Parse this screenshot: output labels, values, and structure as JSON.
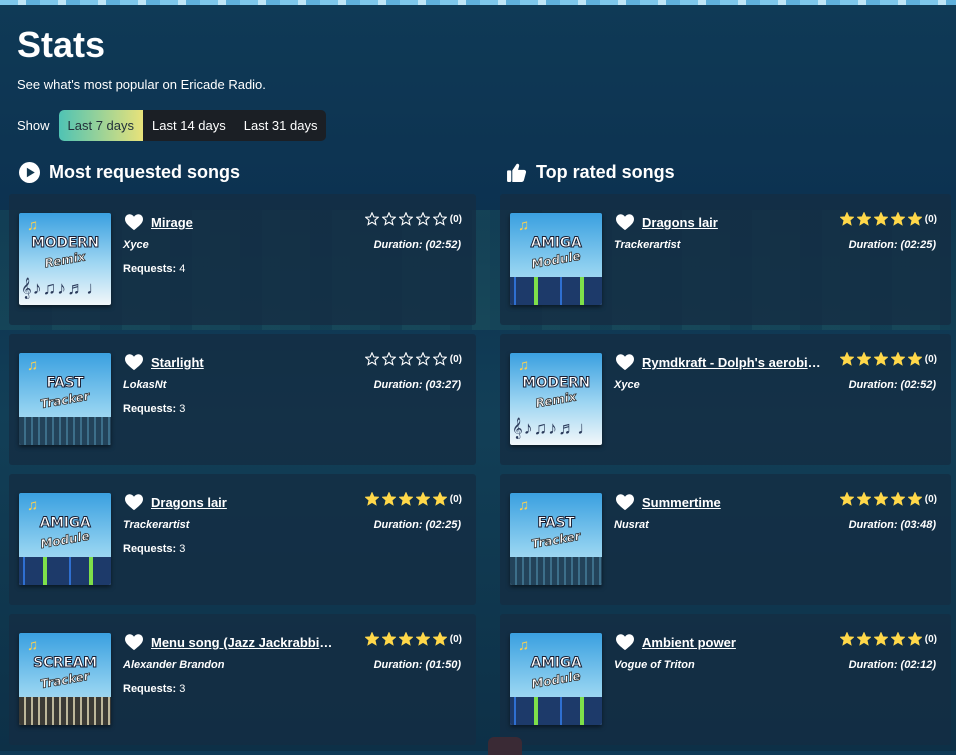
{
  "page": {
    "title": "Stats",
    "subtitle": "See what's most popular on Ericade Radio."
  },
  "filter": {
    "label": "Show",
    "options": [
      "Last 7 days",
      "Last 14 days",
      "Last 31 days"
    ],
    "selected": "Last 7 days"
  },
  "colors": {
    "star_filled": "#ffd84a",
    "accent_gradient": [
      "#4fc3b4",
      "#e8e27a"
    ]
  },
  "sections": {
    "most_requested": {
      "heading": "Most requested songs",
      "icon": "play-circle-icon",
      "songs": [
        {
          "title": "Mirage",
          "artist": "Xyce",
          "requests_label": "Requests:",
          "requests": "4",
          "rating": 0,
          "rating_count": "(0)",
          "duration": "Duration: (02:52)",
          "art": "modern-remix"
        },
        {
          "title": "Starlight",
          "artist": "LokasNt",
          "requests_label": "Requests:",
          "requests": "3",
          "rating": 0,
          "rating_count": "(0)",
          "duration": "Duration: (03:27)",
          "art": "fast-tracker"
        },
        {
          "title": "Dragons lair",
          "artist": "Trackerartist",
          "requests_label": "Requests:",
          "requests": "3",
          "rating": 5,
          "rating_count": "(0)",
          "duration": "Duration: (02:25)",
          "art": "amiga-module"
        },
        {
          "title": "Menu song (Jazz Jackrabbit In...",
          "artist": "Alexander Brandon",
          "requests_label": "Requests:",
          "requests": "3",
          "rating": 5,
          "rating_count": "(0)",
          "duration": "Duration: (01:50)",
          "art": "scream-tracker"
        }
      ]
    },
    "top_rated": {
      "heading": "Top rated songs",
      "icon": "thumbs-up-icon",
      "songs": [
        {
          "title": "Dragons lair",
          "artist": "Trackerartist",
          "rating": 5,
          "rating_count": "(0)",
          "duration": "Duration: (02:25)",
          "art": "amiga-module"
        },
        {
          "title": "Rymdkraft - Dolph's aerobics ...",
          "artist": "Xyce",
          "rating": 5,
          "rating_count": "(0)",
          "duration": "Duration: (02:52)",
          "art": "modern-remix"
        },
        {
          "title": "Summertime",
          "artist": "Nusrat",
          "rating": 5,
          "rating_count": "(0)",
          "duration": "Duration: (03:48)",
          "art": "fast-tracker"
        },
        {
          "title": "Ambient power",
          "artist": "Vogue of Triton",
          "rating": 5,
          "rating_count": "(0)",
          "duration": "Duration: (02:12)",
          "art": "amiga-module"
        }
      ]
    }
  },
  "cover_art": {
    "modern-remix": {
      "line1": "MODERN",
      "line2": "Remix"
    },
    "fast-tracker": {
      "line1": "FAST",
      "line2": "Tracker"
    },
    "amiga-module": {
      "line1": "AMIGA",
      "line2": "Module"
    },
    "scream-tracker": {
      "line1": "SCREAM",
      "line2": "Tracker"
    }
  }
}
